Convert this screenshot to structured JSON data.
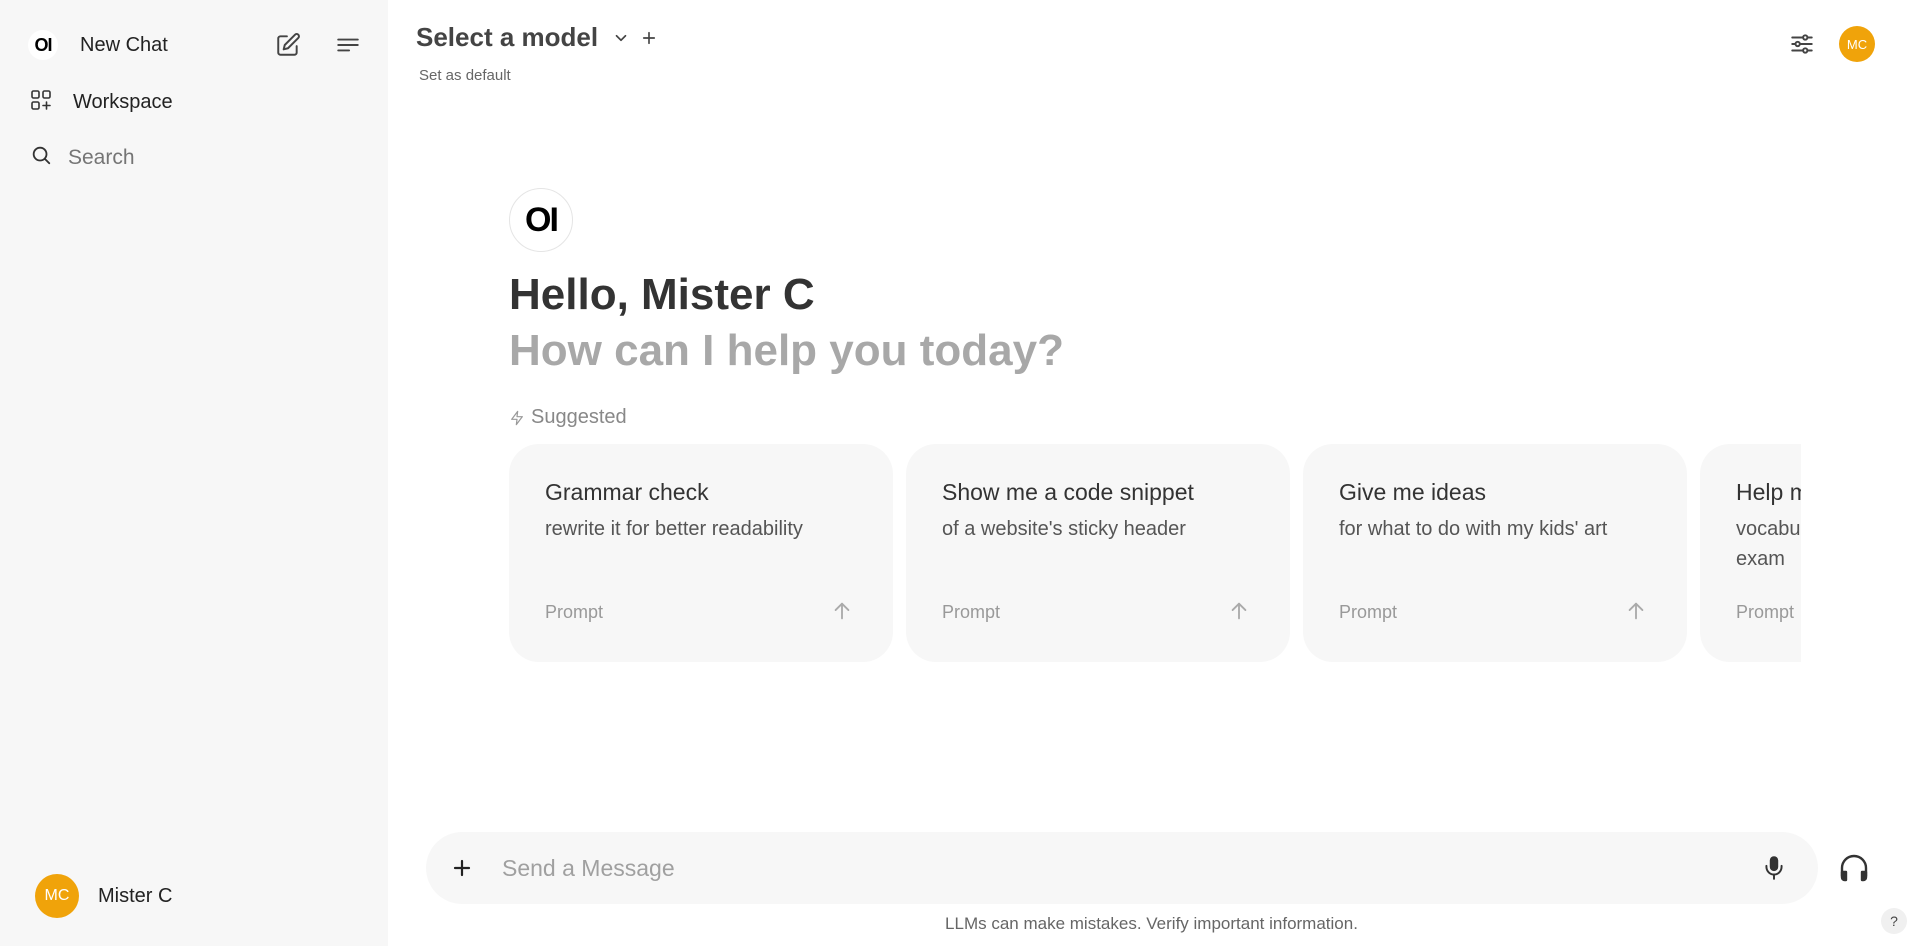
{
  "sidebar": {
    "logo_text": "OI",
    "new_chat_label": "New Chat",
    "workspace_label": "Workspace",
    "search_placeholder": "Search",
    "user": {
      "initials": "MC",
      "name": "Mister C"
    }
  },
  "header": {
    "model_title": "Select a model",
    "set_default_label": "Set as default",
    "avatar_initials": "MC"
  },
  "hero": {
    "logo_text": "OI",
    "greeting": "Hello, Mister C",
    "subgreeting": "How can I help you today?",
    "suggested_label": "Suggested"
  },
  "suggestions": [
    {
      "title": "Grammar check",
      "subtitle": "rewrite it for better readability",
      "footer": "Prompt"
    },
    {
      "title": "Show me a code snippet",
      "subtitle": "of a website's sticky header",
      "footer": "Prompt"
    },
    {
      "title": "Give me ideas",
      "subtitle": "for what to do with my kids' art",
      "footer": "Prompt"
    },
    {
      "title": "Help me study",
      "subtitle": "vocabulary for a college entrance exam",
      "footer": "Prompt"
    }
  ],
  "composer": {
    "placeholder": "Send a Message"
  },
  "footer": {
    "disclaimer": "LLMs can make mistakes. Verify important information.",
    "help_label": "?"
  },
  "colors": {
    "accent_avatar": "#f0a30a",
    "sidebar_bg": "#f7f7f7",
    "card_bg": "#f7f7f7"
  }
}
